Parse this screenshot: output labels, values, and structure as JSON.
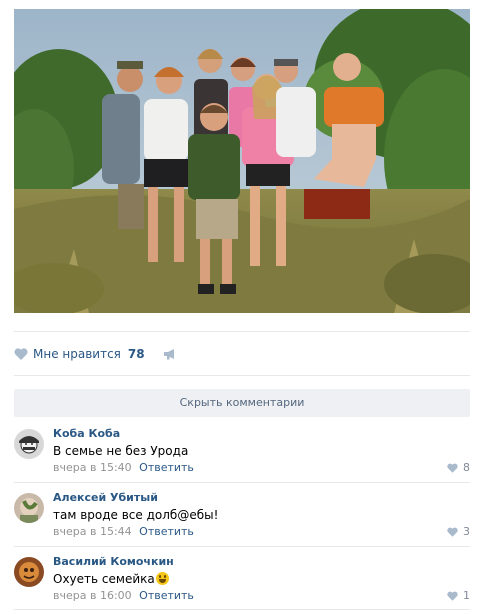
{
  "post": {
    "likes_label": "Мне нравится",
    "likes_count": "78"
  },
  "hide_comments_label": "Скрыть комментарии",
  "comments": [
    {
      "author": "Коба Коба",
      "text": "В семье не без Урода",
      "time": "вчера в 15:40",
      "reply": "Ответить",
      "likes": "8"
    },
    {
      "author": "Алексей Убитый",
      "text": "там вроде все долб@ебы!",
      "time": "вчера в 15:44",
      "reply": "Ответить",
      "likes": "3"
    },
    {
      "author": "Василий Комочкин",
      "text": "Охуеть семейка",
      "time": "вчера в 16:00",
      "reply": "Ответить",
      "likes": "1"
    }
  ],
  "colors": {
    "link": "#2a5885",
    "muted": "#939393",
    "separator": "#e7e8ec",
    "button_bg": "#eef0f3"
  },
  "icons": [
    "heart-icon",
    "megaphone-icon",
    "emoji-laugh-icon"
  ]
}
